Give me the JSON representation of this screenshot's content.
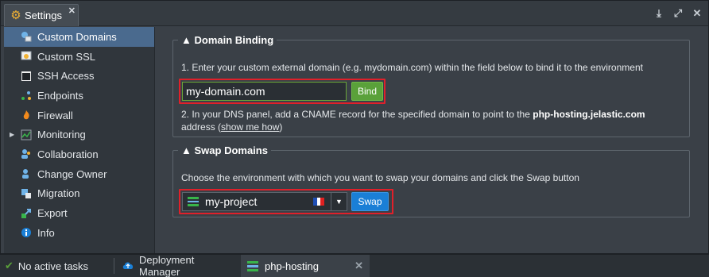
{
  "window": {
    "tab_label": "Settings",
    "tab_icon": "gear-icon",
    "controls": [
      "download-icon",
      "expand-icon",
      "close-icon"
    ]
  },
  "sidebar": {
    "items": [
      {
        "label": "Custom Domains",
        "icon": "globe-icon",
        "active": true
      },
      {
        "label": "Custom SSL",
        "icon": "certificate-icon"
      },
      {
        "label": "SSH Access",
        "icon": "terminal-icon"
      },
      {
        "label": "Endpoints",
        "icon": "endpoints-icon"
      },
      {
        "label": "Firewall",
        "icon": "firewall-icon"
      },
      {
        "label": "Monitoring",
        "icon": "monitoring-icon",
        "expandable": true
      },
      {
        "label": "Collaboration",
        "icon": "users-icon"
      },
      {
        "label": "Change Owner",
        "icon": "user-icon"
      },
      {
        "label": "Migration",
        "icon": "migration-icon"
      },
      {
        "label": "Export",
        "icon": "export-icon"
      },
      {
        "label": "Info",
        "icon": "info-icon"
      }
    ]
  },
  "domain_binding": {
    "title": "Domain Binding",
    "step1": "1. Enter your custom external domain (e.g. mydomain.com) within the field below to bind it to the environment",
    "input_value": "my-domain.com",
    "bind_label": "Bind",
    "step2_prefix": "2. In your DNS panel, add a CNAME record for the specified domain to point to the ",
    "step2_host": "php-hosting.jelastic.com",
    "step2_address": "address (",
    "show_me_how": "show me how",
    "step2_close": ")"
  },
  "swap_domains": {
    "title": "Swap Domains",
    "description": "Choose the environment with which you want to swap your domains and click the Swap button",
    "selected_env": "my-project",
    "swap_label": "Swap"
  },
  "statusbar": {
    "tasks": "No active tasks",
    "tab1": "Deployment Manager",
    "tab2": "php-hosting"
  },
  "colors": {
    "accent_blue": "#1a7fd6",
    "accent_green": "#5aa13a",
    "highlight_red": "#e0202a",
    "active_item": "#4a6a8e"
  }
}
